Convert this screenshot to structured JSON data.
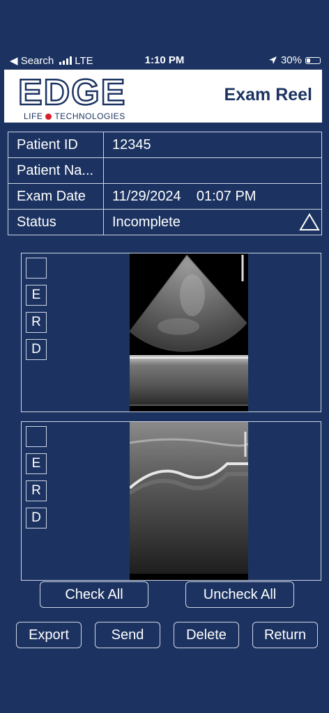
{
  "status_bar": {
    "back_label": "◀ Search",
    "network": "LTE",
    "time": "1:10 PM",
    "battery": "30%"
  },
  "header": {
    "logo_main": "EDGE",
    "logo_sub_left": "LIFE",
    "logo_sub_right": "TECHNOLOGIES",
    "title": "Exam Reel"
  },
  "info": {
    "patient_id_label": "Patient ID",
    "patient_id_value": "12345",
    "patient_name_label": "Patient Na...",
    "patient_name_value": "",
    "exam_date_label": "Exam Date",
    "exam_date_value": "11/29/2024    01:07 PM",
    "status_label": "Status",
    "status_value": "Incomplete"
  },
  "clips": [
    {
      "checks": [
        "",
        "E",
        "R",
        "D"
      ]
    },
    {
      "checks": [
        "",
        "E",
        "R",
        "D"
      ]
    }
  ],
  "buttons": {
    "check_all": "Check All",
    "uncheck_all": "Uncheck All",
    "export": "Export",
    "send": "Send",
    "delete": "Delete",
    "return": "Return"
  }
}
